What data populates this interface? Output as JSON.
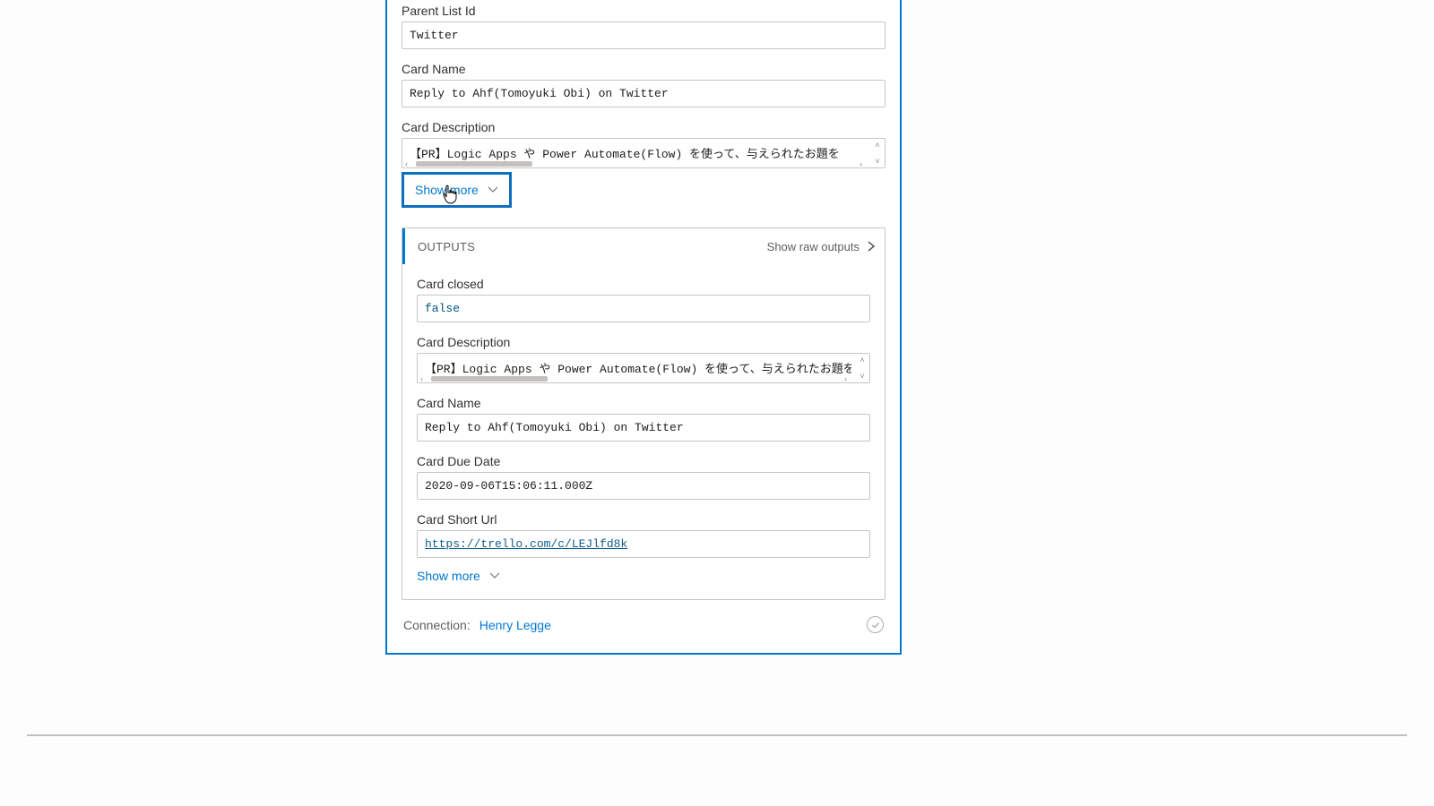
{
  "inputs": {
    "parent_list_id": {
      "label": "Parent List Id",
      "value": "Twitter"
    },
    "card_name": {
      "label": "Card Name",
      "value": "Reply to Ahf(Tomoyuki Obi) on Twitter"
    },
    "card_description": {
      "label": "Card Description",
      "value": "【PR】Logic Apps や Power Automate(Flow) を使って、与えられたお題を"
    },
    "show_more": "Show more"
  },
  "outputs": {
    "title": "OUTPUTS",
    "raw_link": "Show raw outputs",
    "card_closed": {
      "label": "Card closed",
      "value": "false"
    },
    "card_description": {
      "label": "Card Description",
      "value": "【PR】Logic Apps や Power Automate(Flow) を使って、与えられたお題を"
    },
    "card_name": {
      "label": "Card Name",
      "value": "Reply to Ahf(Tomoyuki Obi) on Twitter"
    },
    "card_due_date": {
      "label": "Card Due Date",
      "value": "2020-09-06T15:06:11.000Z"
    },
    "card_short_url": {
      "label": "Card Short Url",
      "value": "https://trello.com/c/LEJlfd8k"
    },
    "show_more": "Show more"
  },
  "connection": {
    "label": "Connection:",
    "name": "Henry Legge"
  }
}
